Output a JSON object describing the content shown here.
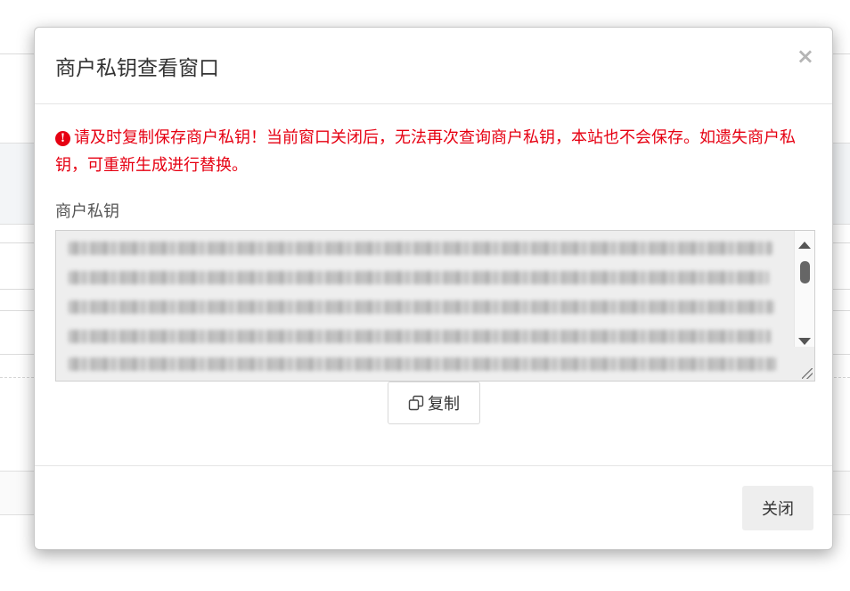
{
  "modal": {
    "title": "商户私钥查看窗口",
    "close_symbol": "×",
    "warning_icon": "exclamation-circle-icon",
    "warning_text": "请及时复制保存商户私钥！当前窗口关闭后，无法再次查询商户私钥，本站也不会保存。如遗失商户私钥，可重新生成进行替换。",
    "key_label": "商户私钥",
    "copy_label": "复制",
    "close_label": "关闭"
  },
  "colors": {
    "warning": "#e60012",
    "title": "#333333",
    "close_button_bg": "#eeeeee",
    "key_box_bg": "#eeeeee"
  }
}
